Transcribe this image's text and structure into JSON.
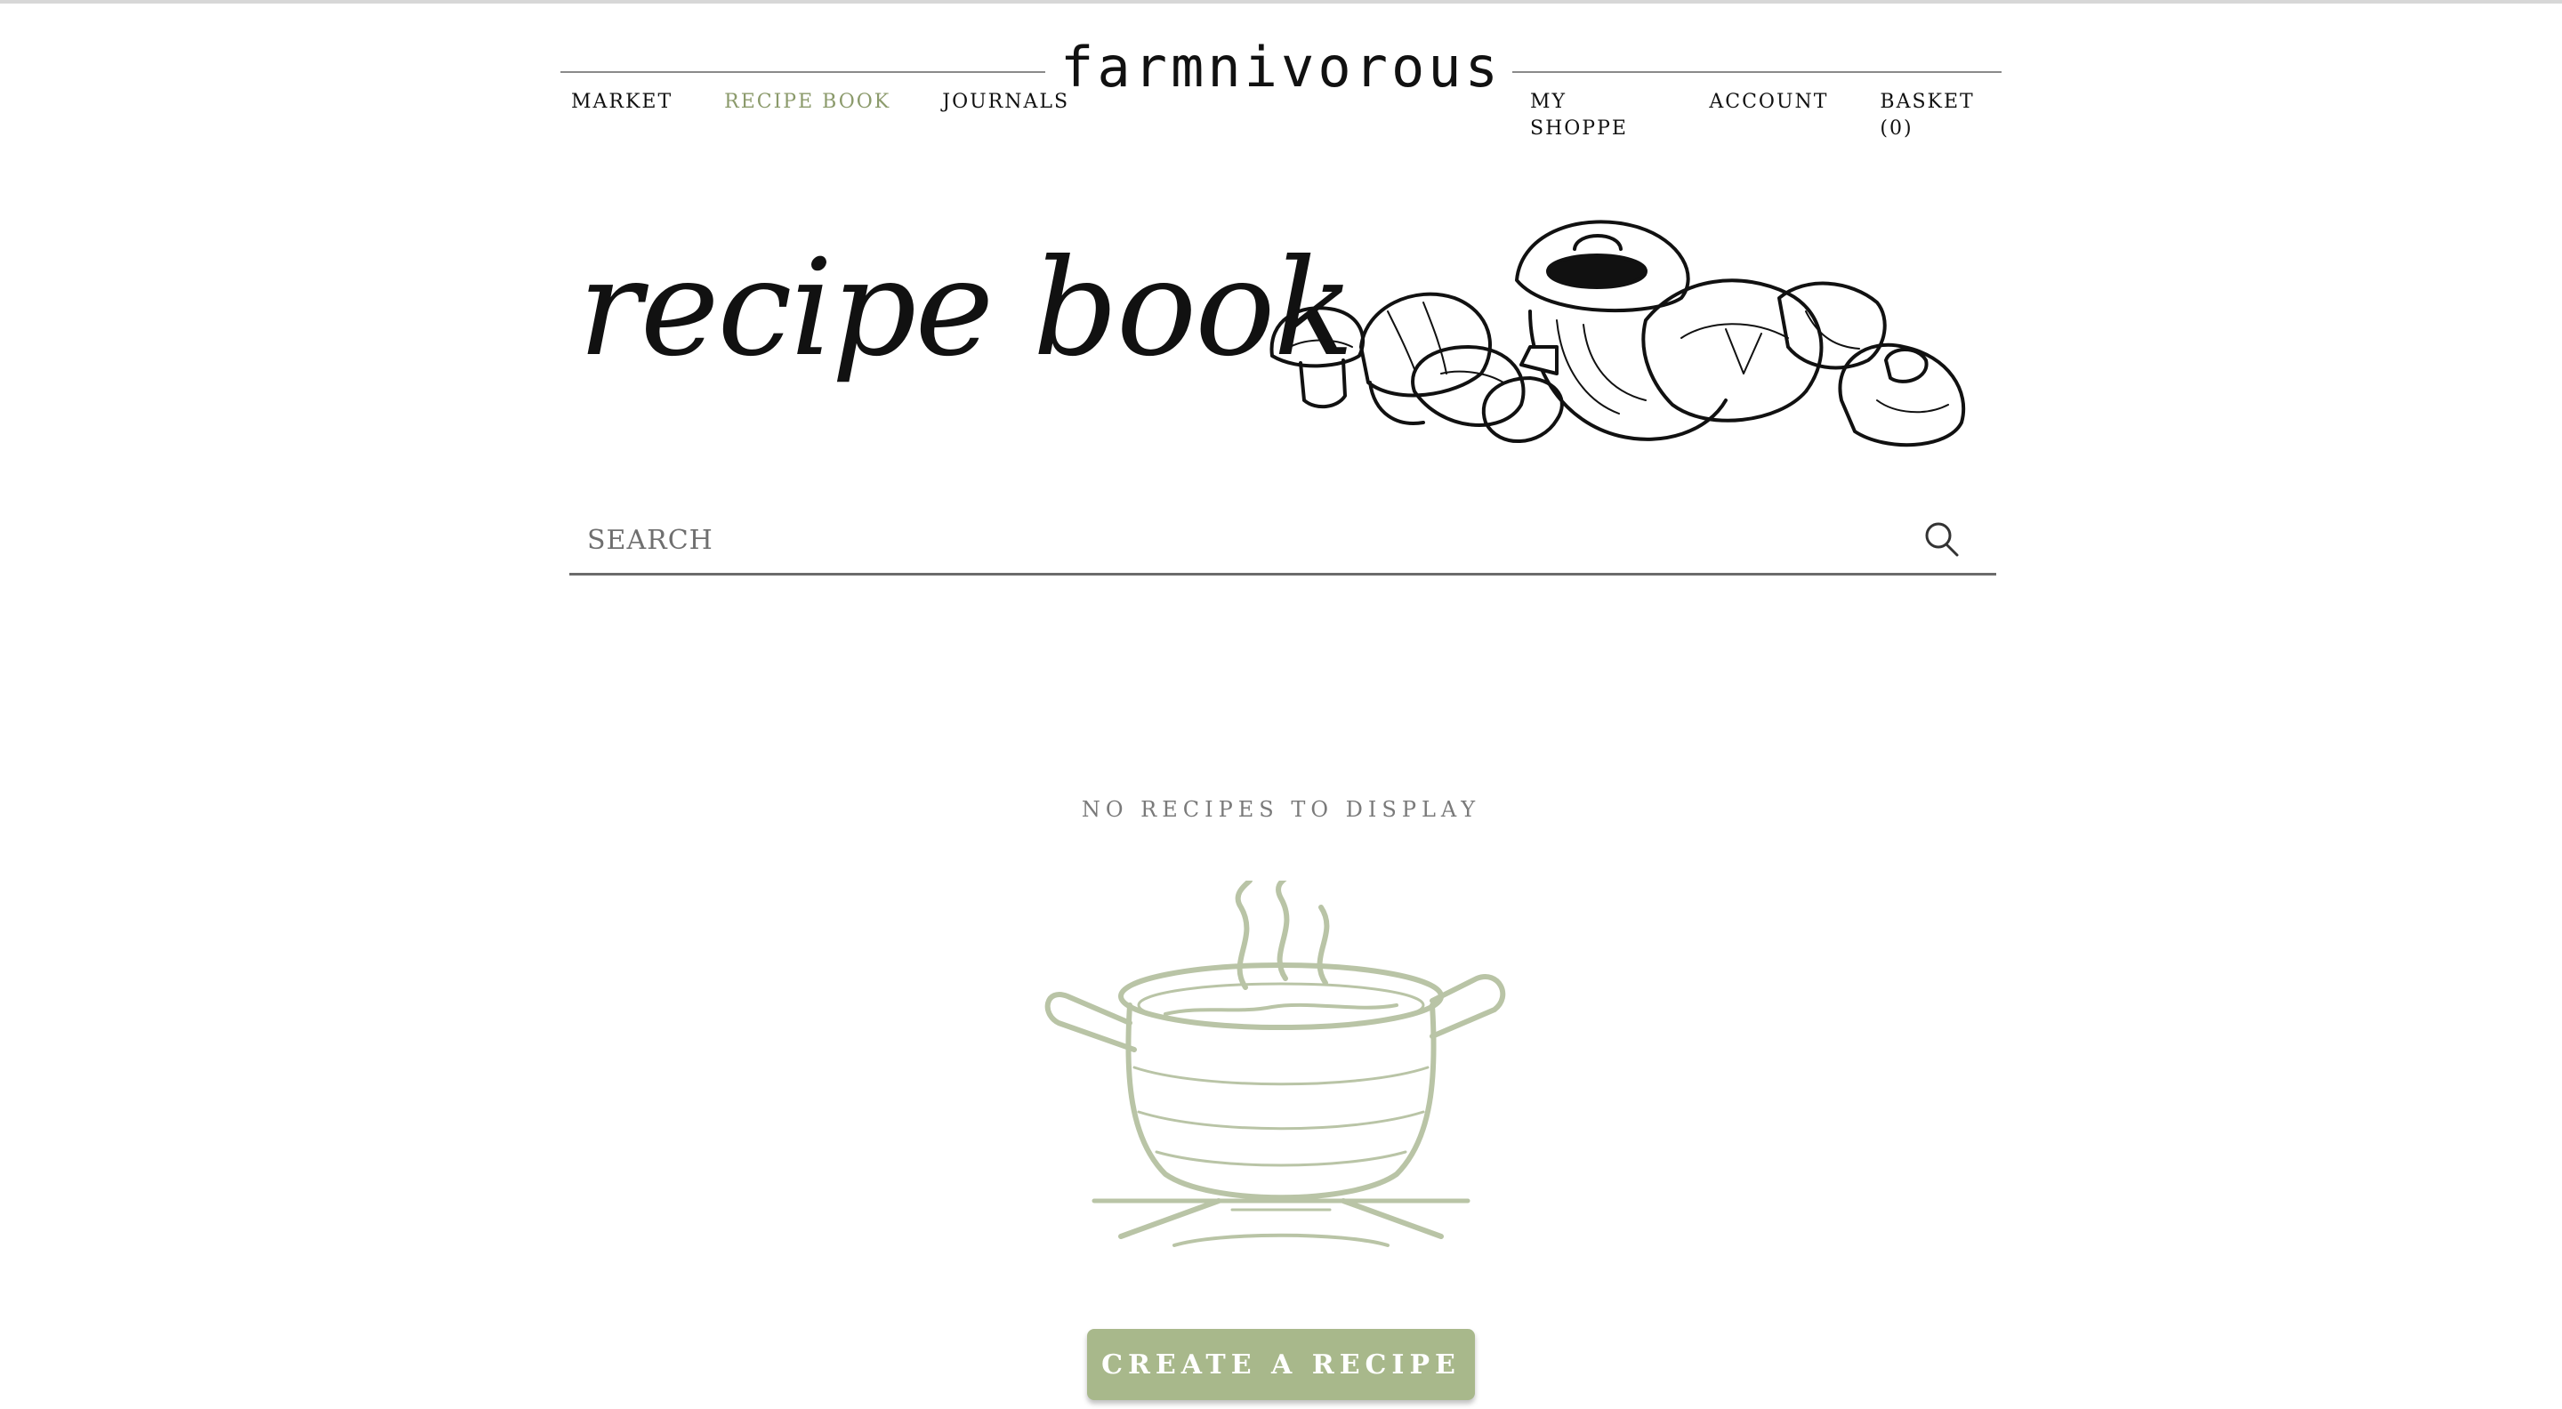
{
  "brand": {
    "logo_text": "farmnivorous"
  },
  "nav": {
    "left": [
      {
        "label": "MARKET",
        "active": false
      },
      {
        "label": "RECIPE BOOK",
        "active": true
      },
      {
        "label": "JOURNALS",
        "active": false
      }
    ],
    "right": [
      {
        "label": "MY SHOPPE"
      },
      {
        "label": "ACCOUNT"
      },
      {
        "label": "BASKET (0)"
      }
    ]
  },
  "hero": {
    "title": "recipe book",
    "illustration": "mushrooms-illustration"
  },
  "search": {
    "placeholder": "SEARCH",
    "value": "",
    "icon": "search-icon"
  },
  "empty_state": {
    "message": "NO RECIPES TO DISPLAY",
    "illustration": "cooking-pot-illustration",
    "cta_label": "CREATE A RECIPE"
  },
  "colors": {
    "accent": "#8b9a6b",
    "button_bg": "#a8b88b",
    "pot_sketch": "#b9c4a6",
    "text": "#111111",
    "muted": "#7a7a7a"
  }
}
